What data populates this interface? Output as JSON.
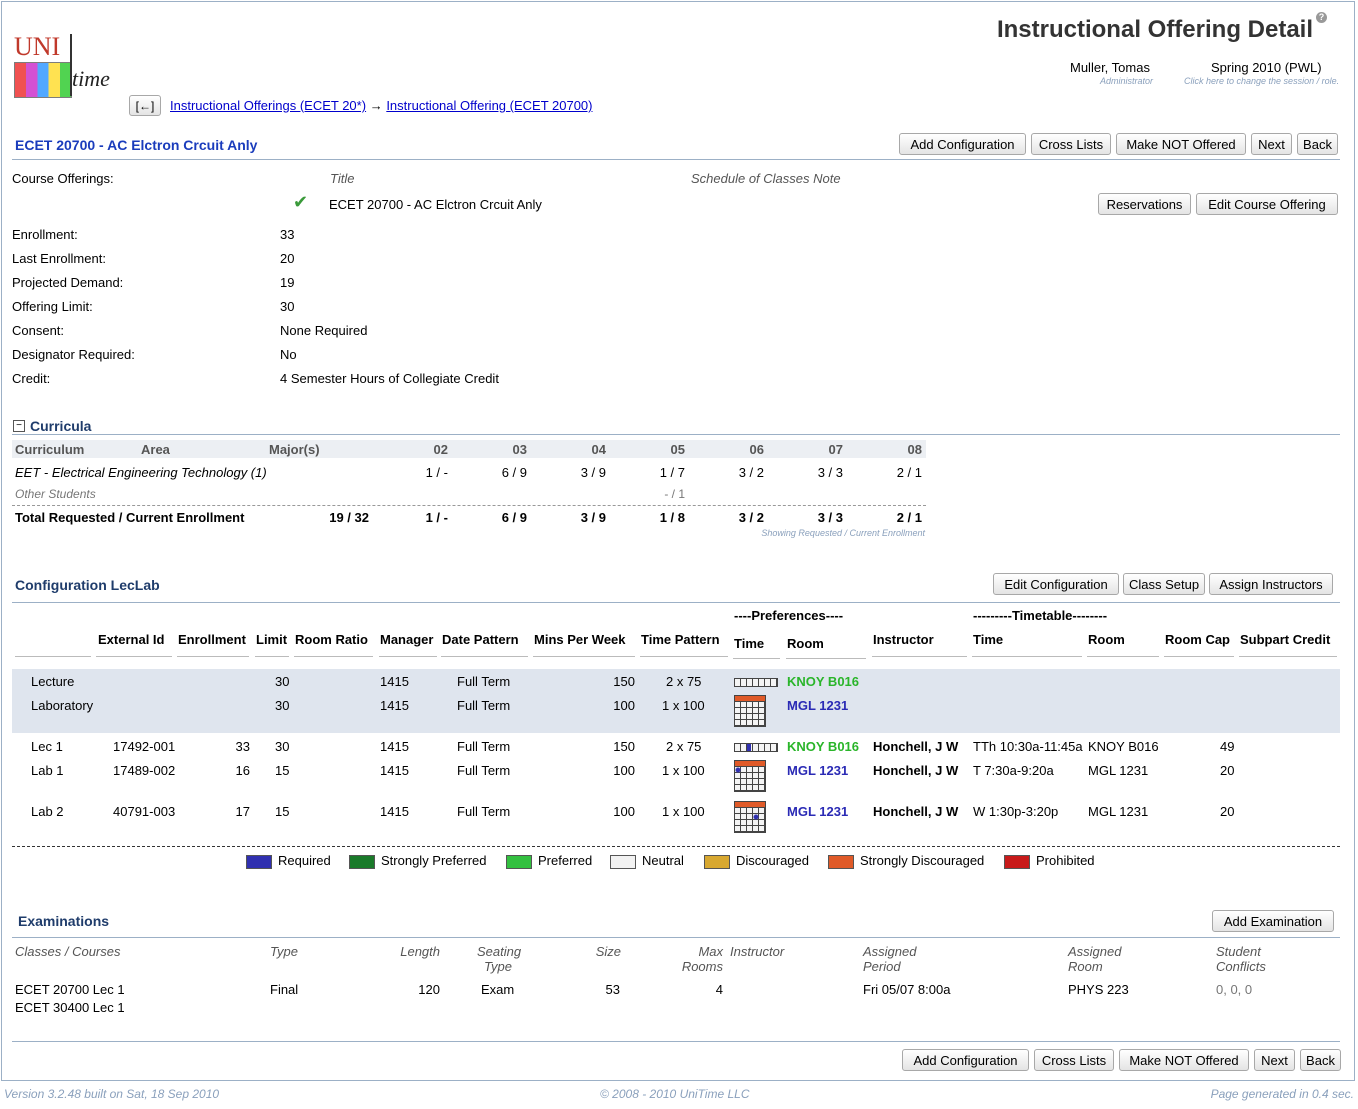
{
  "header": {
    "logo_uni": "UNI",
    "logo_time": "time",
    "title": "Instructional Offering Detail",
    "help_icon": "help-icon",
    "user_name": "Muller, Tomas",
    "user_role": "Administrator",
    "session": "Spring 2010 (PWL)",
    "session_hint": "Click here to change the session / role."
  },
  "breadcrumb": {
    "back": "[←]",
    "link1": "Instructional Offerings (ECET 20*)",
    "arrow": "→",
    "link2": "Instructional Offering (ECET 20700)"
  },
  "offering": {
    "title": "ECET 20700 - AC Elctron Crcuit Anly",
    "buttons": [
      "Add Configuration",
      "Cross Lists",
      "Make NOT Offered",
      "Next",
      "Back"
    ],
    "course_offerings_label": "Course Offerings:",
    "col_title": "Title",
    "col_note": "Schedule of Classes Note",
    "course_title": "ECET 20700 - AC Elctron Crcuit Anly",
    "reservations_btn": "Reservations",
    "edit_course_btn": "Edit Course Offering",
    "props": [
      {
        "label": "Enrollment:",
        "value": "33"
      },
      {
        "label": "Last Enrollment:",
        "value": "20"
      },
      {
        "label": "Projected Demand:",
        "value": "19"
      },
      {
        "label": "Offering Limit:",
        "value": "30"
      },
      {
        "label": "Consent:",
        "value": "None Required"
      },
      {
        "label": "Designator Required:",
        "value": "No"
      },
      {
        "label": "Credit:",
        "value": "4 Semester Hours of Collegiate Credit"
      }
    ]
  },
  "curricula": {
    "title": "Curricula",
    "toggle": "−",
    "headers": [
      "Curriculum",
      "Area",
      "Major(s)",
      "02",
      "03",
      "04",
      "05",
      "06",
      "07",
      "08"
    ],
    "rows": [
      {
        "name": "EET - Electrical Engineering Technology (1)",
        "total": "",
        "vals": [
          "1 / -",
          "6 / 9",
          "3 / 9",
          "1 / 7",
          "3 / 2",
          "3 / 3",
          "2 / 1"
        ]
      },
      {
        "name": "Other Students",
        "total": "",
        "vals": [
          "",
          "",
          "",
          "- / 1",
          "",
          "",
          ""
        ]
      }
    ],
    "total": {
      "name": "Total Requested / Current Enrollment",
      "total": "19 / 32",
      "vals": [
        "1 / -",
        "6 / 9",
        "3 / 9",
        "1 / 8",
        "3 / 2",
        "3 / 3",
        "2 / 1"
      ]
    },
    "note": "Showing Requested / Current Enrollment"
  },
  "config": {
    "title": "Configuration LecLab",
    "buttons": [
      "Edit Configuration",
      "Class Setup",
      "Assign Instructors"
    ],
    "group_prefs": "----Preferences----",
    "group_tt": "---------Timetable--------",
    "headers": [
      "External Id",
      "Enrollment",
      "Limit",
      "Room Ratio",
      "Manager",
      "Date Pattern",
      "Mins Per Week",
      "Time Pattern",
      "Time",
      "Room",
      "Instructor",
      "Time",
      "Room",
      "Room Cap",
      "Subpart Credit"
    ],
    "subparts": [
      {
        "name": "Lecture",
        "limit": "30",
        "manager": "1415",
        "date": "Full Term",
        "mins": "150",
        "tp": "2 x 75",
        "room": "KNOY B016",
        "room_color": "green"
      },
      {
        "name": "Laboratory",
        "limit": "30",
        "manager": "1415",
        "date": "Full Term",
        "mins": "100",
        "tp": "1 x 100",
        "room": "MGL 1231",
        "room_color": "blue"
      }
    ],
    "classes": [
      {
        "name": "Lec 1",
        "ext": "17492-001",
        "enrl": "33",
        "limit": "30",
        "manager": "1415",
        "date": "Full Term",
        "mins": "150",
        "tp": "2 x 75",
        "room": "KNOY B016",
        "room_color": "green",
        "instructor": "Honchell, J W",
        "time": "TTh 10:30a-11:45a",
        "asg_room": "KNOY B016",
        "cap": "49"
      },
      {
        "name": "Lab 1",
        "ext": "17489-002",
        "enrl": "16",
        "limit": "15",
        "manager": "1415",
        "date": "Full Term",
        "mins": "100",
        "tp": "1 x 100",
        "room": "MGL 1231",
        "room_color": "blue",
        "instructor": "Honchell, J W",
        "time": "T 7:30a-9:20a",
        "asg_room": "MGL 1231",
        "cap": "20"
      },
      {
        "name": "Lab 2",
        "ext": "40791-003",
        "enrl": "17",
        "limit": "15",
        "manager": "1415",
        "date": "Full Term",
        "mins": "100",
        "tp": "1 x 100",
        "room": "MGL 1231",
        "room_color": "blue",
        "instructor": "Honchell, J W",
        "time": "W 1:30p-3:20p",
        "asg_room": "MGL 1231",
        "cap": "20"
      }
    ]
  },
  "legend": [
    {
      "label": "Required",
      "color": "#3030b0"
    },
    {
      "label": "Strongly Preferred",
      "color": "#1a7a2a"
    },
    {
      "label": "Preferred",
      "color": "#33c040"
    },
    {
      "label": "Neutral",
      "color": "#f2f2f2"
    },
    {
      "label": "Discouraged",
      "color": "#d8a830"
    },
    {
      "label": "Strongly Discouraged",
      "color": "#e05a28"
    },
    {
      "label": "Prohibited",
      "color": "#c81a1a"
    }
  ],
  "exams": {
    "title": "Examinations",
    "add_btn": "Add Examination",
    "headers": {
      "classes": "Classes / Courses",
      "type": "Type",
      "length": "Length",
      "seating1": "Seating",
      "seating2": "Type",
      "size": "Size",
      "max1": "Max",
      "max2": "Rooms",
      "instructor": "Instructor",
      "period1": "Assigned",
      "period2": "Period",
      "room1": "Assigned",
      "room2": "Room",
      "conf1": "Student",
      "conf2": "Conflicts"
    },
    "row": {
      "course1": "ECET 20700 Lec 1",
      "course2": "ECET 30400 Lec 1",
      "type": "Final",
      "length": "120",
      "seating": "Exam",
      "size": "53",
      "max_rooms": "4",
      "instructor": "",
      "period": "Fri 05/07 8:00a",
      "room": "PHYS 223",
      "conflicts": "0, 0, 0"
    }
  },
  "bottom_buttons": [
    "Add Configuration",
    "Cross Lists",
    "Make NOT Offered",
    "Next",
    "Back"
  ],
  "footer": {
    "version": "Version 3.2.48 built on Sat, 18 Sep 2010",
    "copyright": "© 2008 - 2010 UniTime LLC",
    "generated": "Page generated in 0.4 sec."
  }
}
